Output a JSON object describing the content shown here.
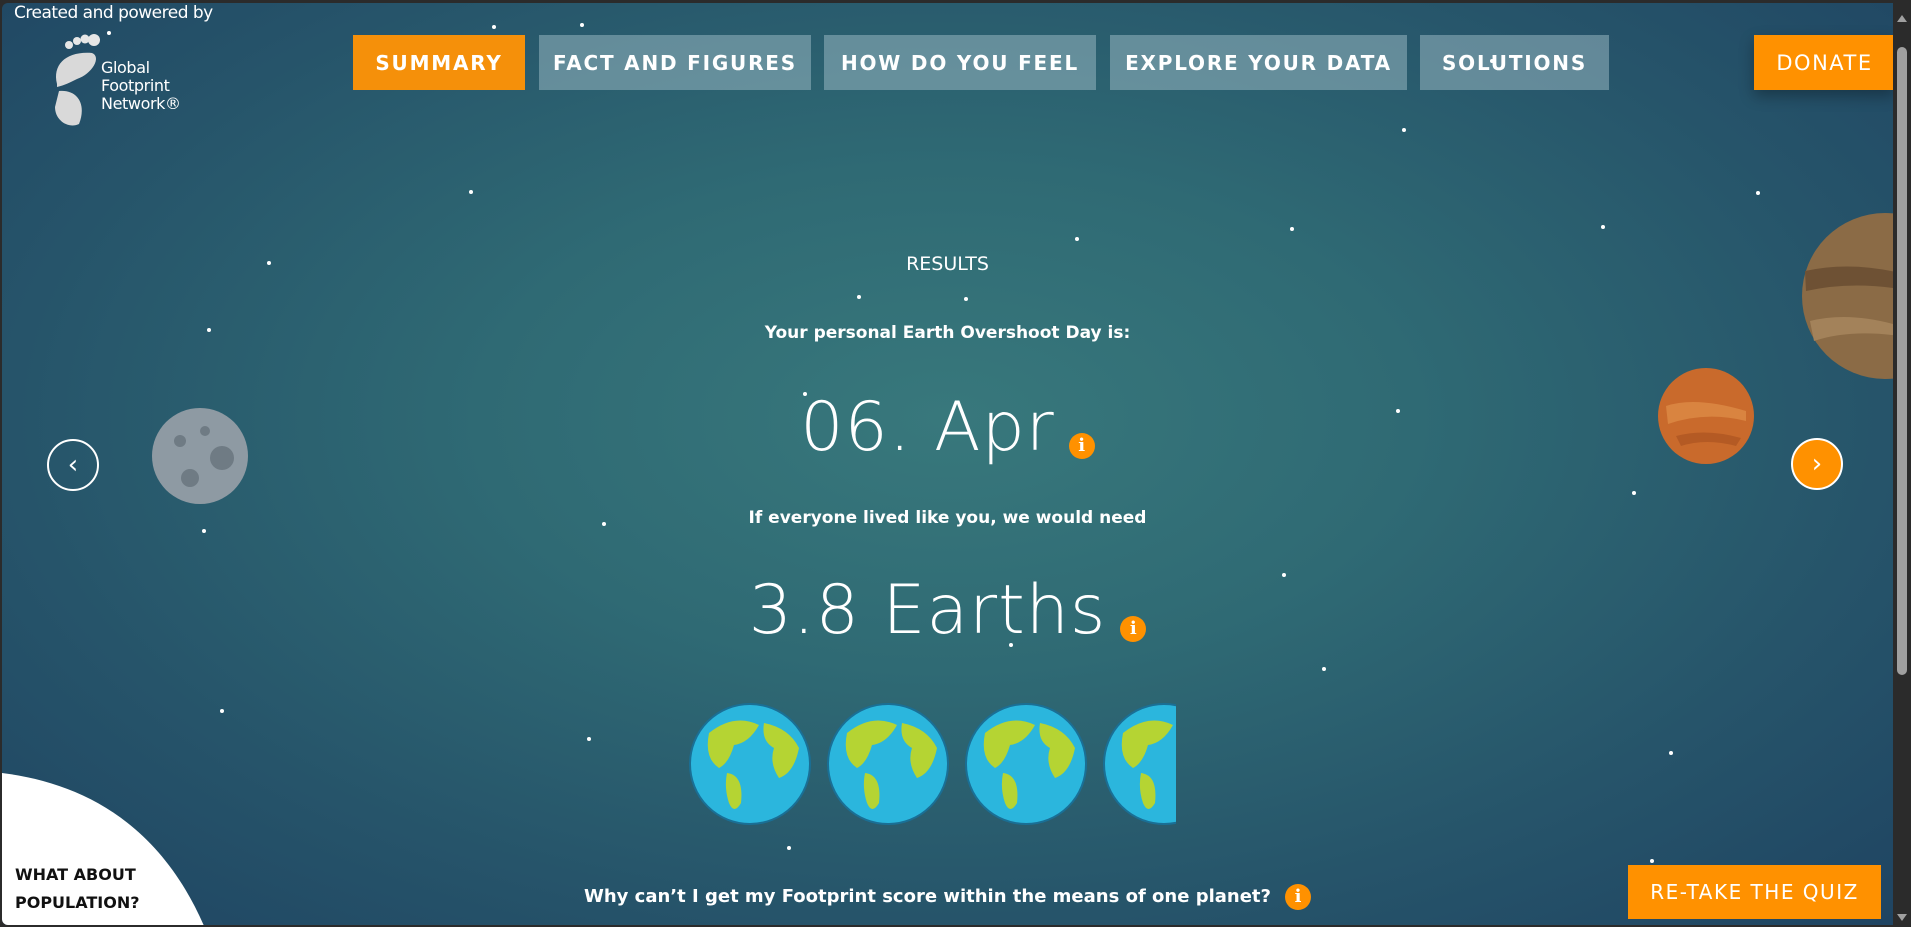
{
  "header": {
    "credit": "Created and powered by",
    "logo_text": [
      "Global",
      "Footprint",
      "Network®"
    ]
  },
  "nav": {
    "items": [
      {
        "label": "SUMMARY",
        "active": true
      },
      {
        "label": "FACT AND FIGURES",
        "active": false
      },
      {
        "label": "HOW DO YOU FEEL",
        "active": false
      },
      {
        "label": "EXPLORE YOUR DATA",
        "active": false
      },
      {
        "label": "SOLUTIONS",
        "active": false
      }
    ],
    "donate_label": "DONATE"
  },
  "results": {
    "title": "RESULTS",
    "overshoot_label": "Your personal Earth Overshoot Day is:",
    "overshoot_date": "06. Apr",
    "earths_label": "If everyone lived like you, we would need",
    "earths_value": "3.8 Earths",
    "earths_count": 3.8,
    "info_glyph": "i",
    "question": "Why can’t I get my Footprint score within the means of one planet?"
  },
  "population_link": "WHAT ABOUT POPULATION?",
  "retake_label": "RE-TAKE THE QUIZ",
  "icons": {
    "prev": "chevron-left-icon",
    "next": "chevron-right-icon",
    "info": "info-icon"
  },
  "colors": {
    "accent": "#ff9100",
    "background": "#2f6a74"
  }
}
